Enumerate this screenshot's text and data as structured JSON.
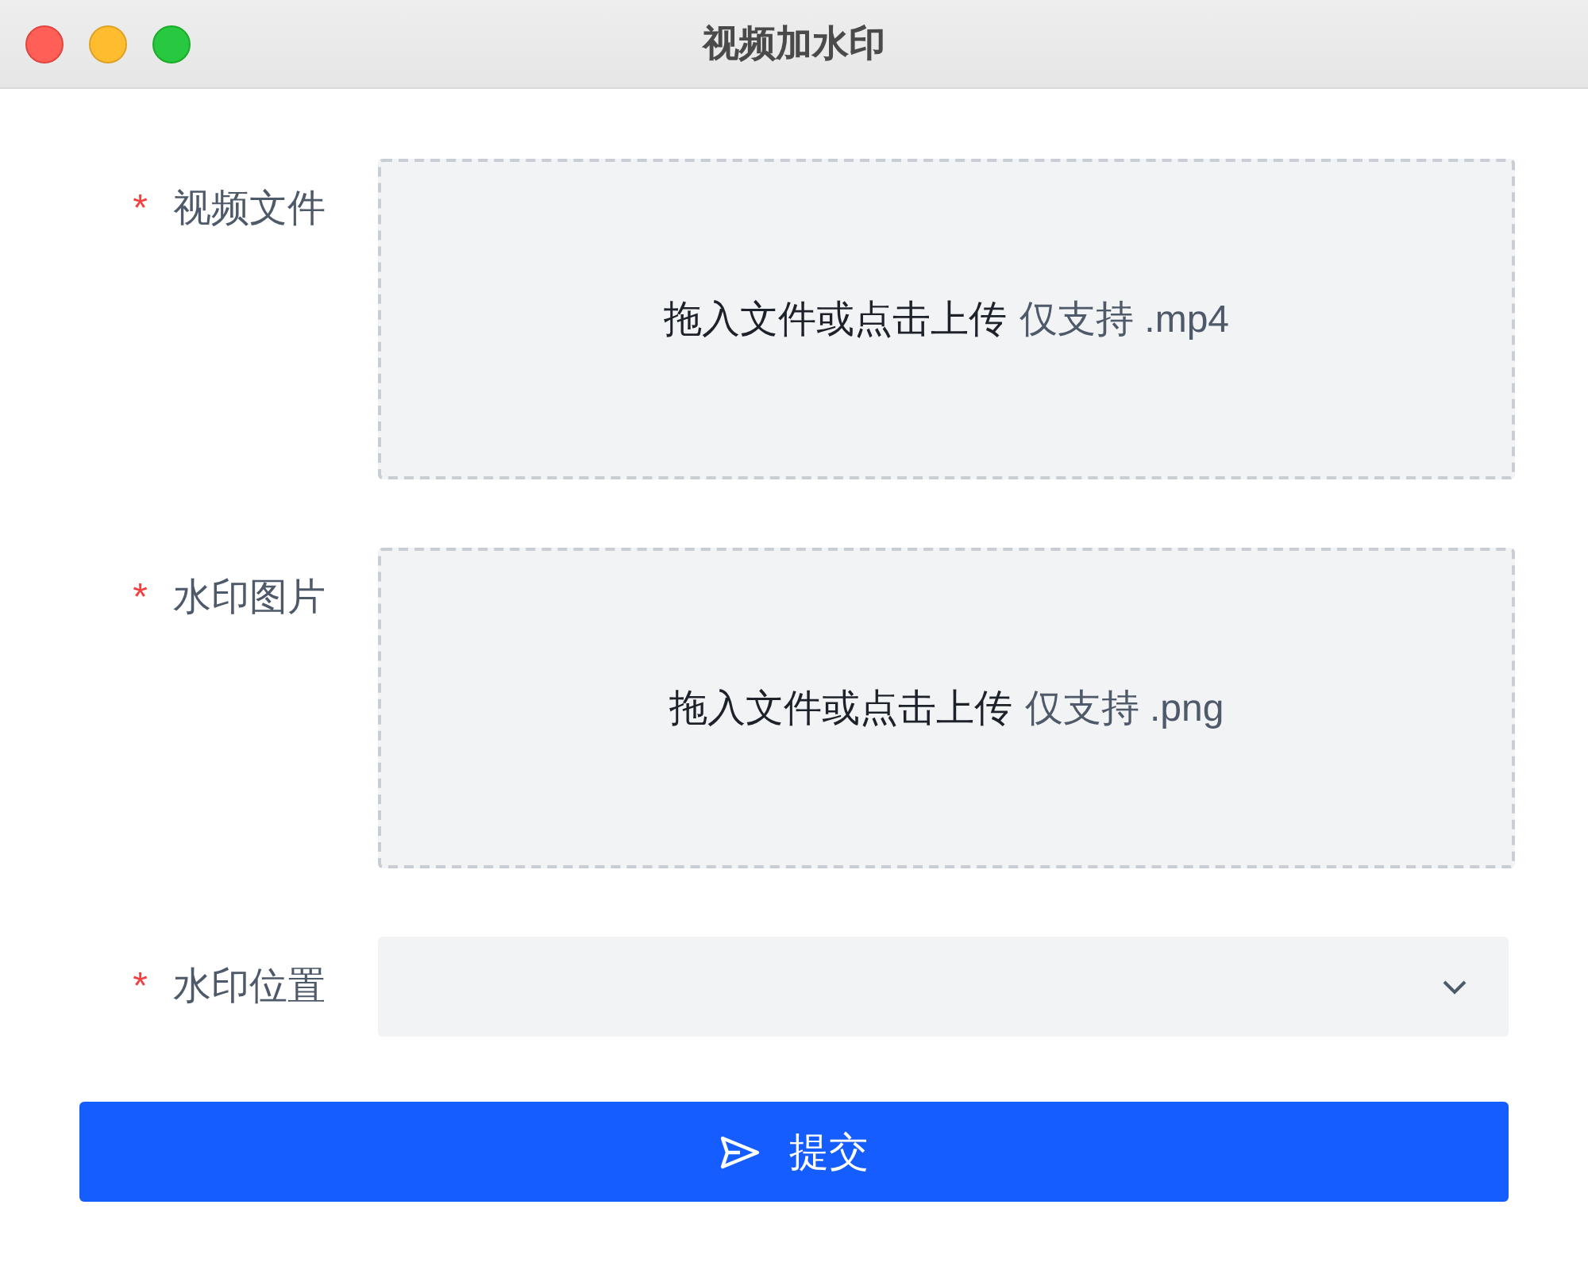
{
  "window": {
    "title": "视频加水印"
  },
  "form": {
    "fields": [
      {
        "kind": "upload",
        "required_mark": "*",
        "label": "视频文件",
        "prompt": "拖入文件或点击上传",
        "hint": "仅支持 .mp4"
      },
      {
        "kind": "upload",
        "required_mark": "*",
        "label": "水印图片",
        "prompt": "拖入文件或点击上传",
        "hint": "仅支持 .png"
      },
      {
        "kind": "select",
        "required_mark": "*",
        "label": "水印位置"
      }
    ]
  },
  "submit_button": {
    "label": "提交"
  }
}
